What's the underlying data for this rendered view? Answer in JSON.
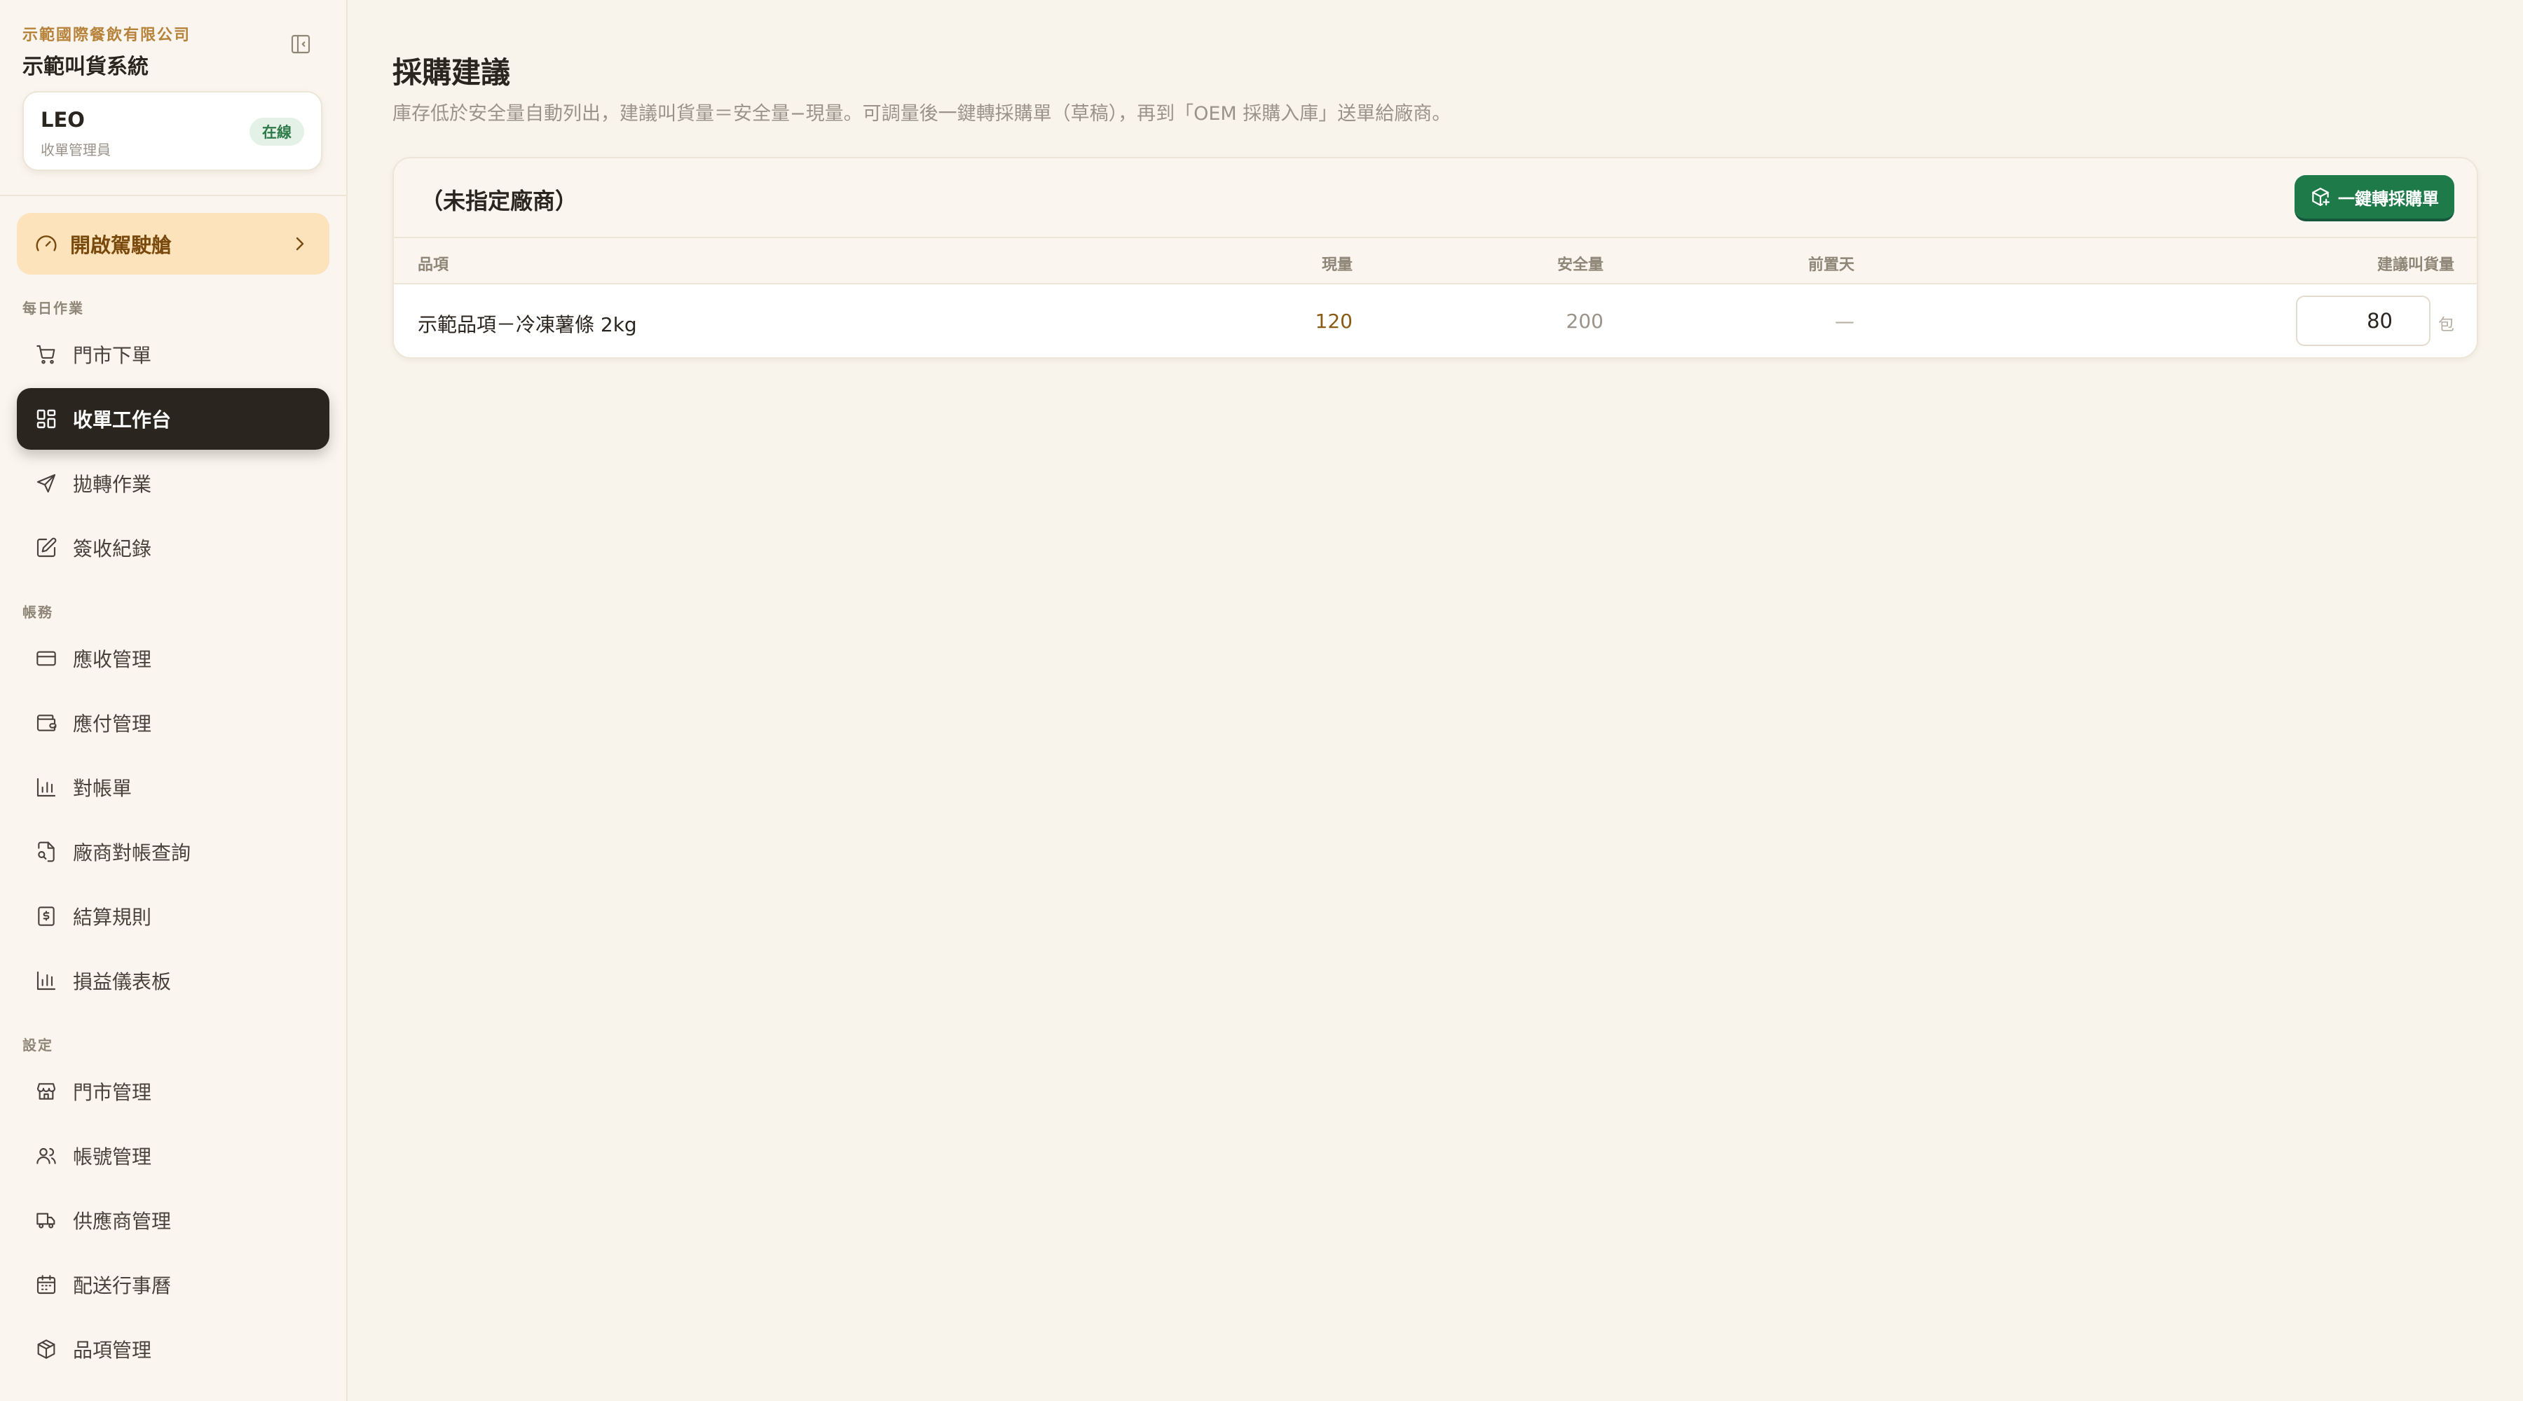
{
  "sidebar": {
    "company": "示範國際餐飲有限公司",
    "system_name": "示範叫貨系統",
    "user": {
      "name": "LEO",
      "role": "收單管理員",
      "status": "在線"
    },
    "cockpit_label": "開啟駕駛艙",
    "sections": {
      "daily": "每日作業",
      "accounts": "帳務",
      "settings": "設定"
    },
    "items": {
      "store_order": "門市下單",
      "order_workbench": "收單工作台",
      "transfer": "拋轉作業",
      "receipt_records": "簽收紀錄",
      "receivables": "應收管理",
      "payables": "應付管理",
      "statements": "對帳單",
      "vendor_reconcile": "廠商對帳查詢",
      "settlement_rules": "結算規則",
      "pnl_dashboard": "損益儀表板",
      "store_mgmt": "門市管理",
      "account_mgmt": "帳號管理",
      "supplier_mgmt": "供應商管理",
      "delivery_calendar": "配送行事曆",
      "item_mgmt": "品項管理"
    }
  },
  "main": {
    "title": "採購建議",
    "description": "庫存低於安全量自動列出，建議叫貨量＝安全量−現量。可調量後一鍵轉採購單（草稿），再到「OEM 採購入庫」送單給廠商。",
    "panel": {
      "vendor": "（未指定廠商）",
      "convert_button": "一鍵轉採購單",
      "columns": {
        "item": "品項",
        "current_qty": "現量",
        "safety_qty": "安全量",
        "lead_days": "前置天",
        "suggested_qty": "建議叫貨量"
      },
      "rows": [
        {
          "item": "示範品項－冷凍薯條 2kg",
          "current_qty": "120",
          "safety_qty": "200",
          "lead_days": "—",
          "suggested_qty": "80",
          "unit": "包"
        }
      ]
    }
  },
  "colors": {
    "accent_brand": "#b7823a",
    "active_nav": "#2b2520",
    "cockpit_bg": "#fde3bc",
    "primary_button": "#1f7a4a",
    "current_qty_text": "#8a5a12",
    "status_online": "#2f7a49"
  },
  "icons": {
    "collapse": "sidebar-collapse-icon",
    "cockpit": "gauge-icon",
    "store_order": "cart-icon",
    "order_workbench": "grid-icon",
    "transfer": "send-icon",
    "receipt_records": "edit-icon",
    "receivables": "credit-card-icon",
    "payables": "wallet-icon",
    "statements": "bar-chart-icon",
    "vendor_reconcile": "file-search-icon",
    "settlement_rules": "dollar-receipt-icon",
    "pnl_dashboard": "bar-chart-icon",
    "store_mgmt": "store-icon",
    "account_mgmt": "users-icon",
    "supplier_mgmt": "truck-icon",
    "delivery_calendar": "calendar-icon",
    "item_mgmt": "package-icon",
    "convert": "package-plus-icon"
  }
}
